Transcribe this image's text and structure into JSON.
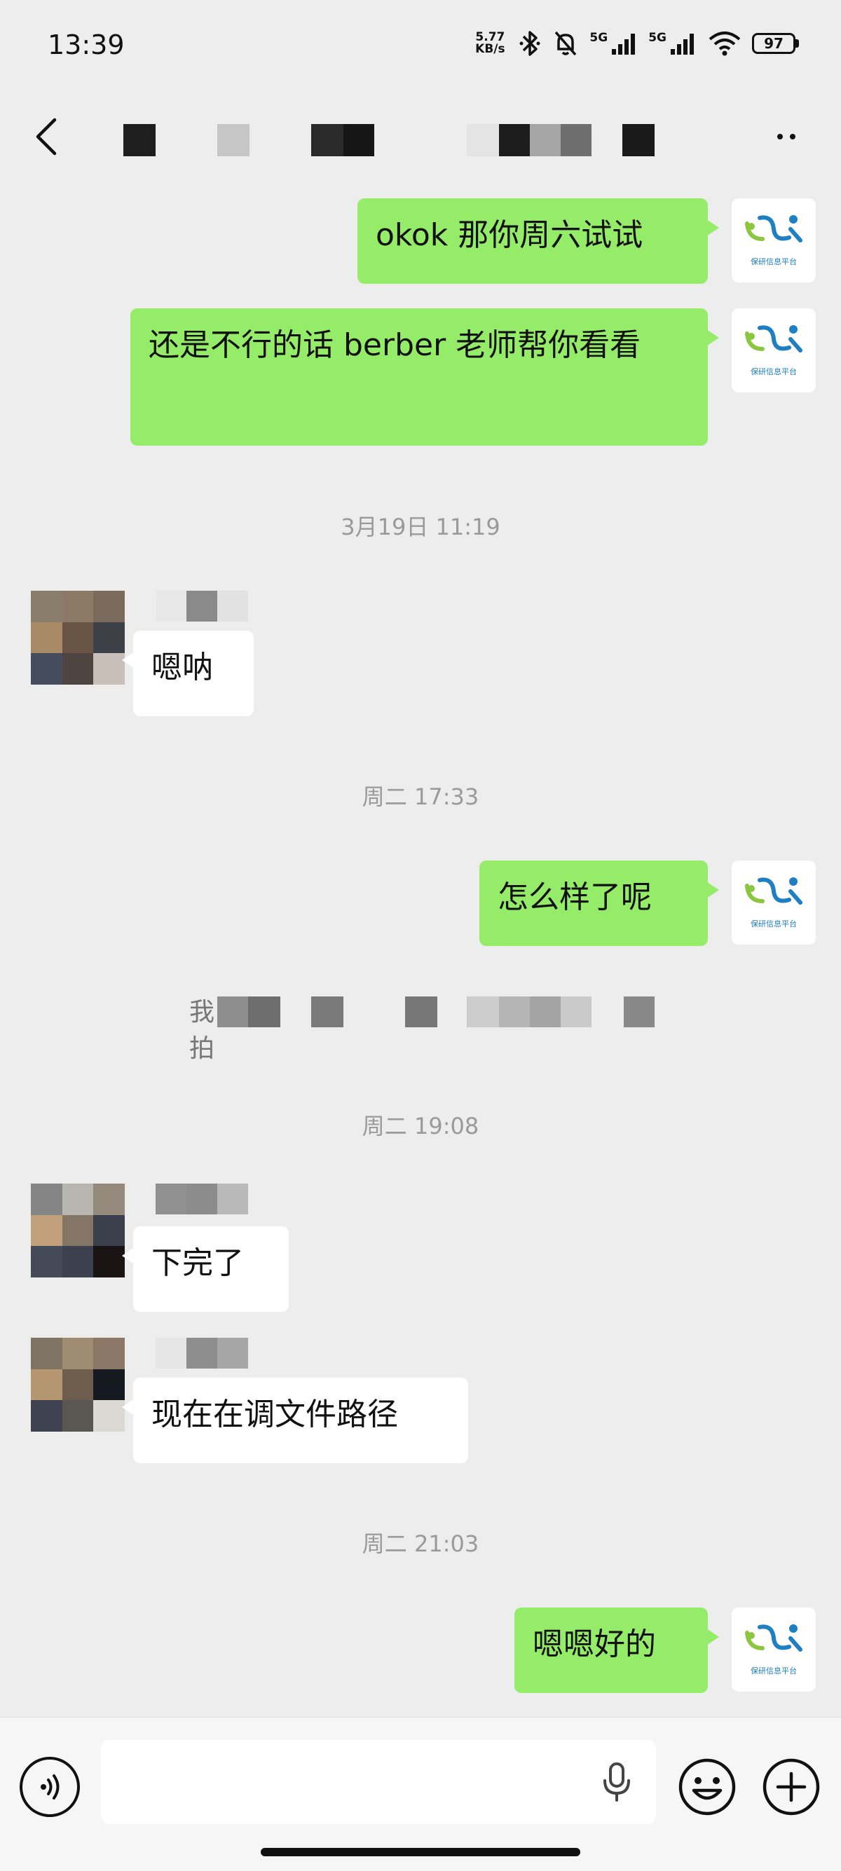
{
  "status_bar": {
    "time": "13:39",
    "net_speed_value": "5.77",
    "net_speed_unit": "KB/s",
    "signal_1_label": "5G",
    "signal_2_label": "5G",
    "battery": "97"
  },
  "messages": [
    {
      "direction": "out",
      "text": "okok 那你周六试试"
    },
    {
      "direction": "out",
      "text": "还是不行的话 berber 老师帮你看看"
    },
    {
      "direction": "in",
      "text": "嗯呐"
    },
    {
      "direction": "out",
      "text": "怎么样了呢"
    },
    {
      "direction": "in",
      "text": "下完了"
    },
    {
      "direction": "in",
      "text": "现在在调文件路径"
    },
    {
      "direction": "out",
      "text": "嗯嗯好的"
    }
  ],
  "timestamps": [
    "3月19日 11:19",
    "周二 17:33",
    "周二 19:08",
    "周二 21:03"
  ],
  "system_note_visible_fragment": "我拍",
  "self_avatar_caption": "保研信息平台",
  "colors": {
    "background": "#ededed",
    "outgoing_bubble": "#95ec69",
    "incoming_bubble": "#ffffff",
    "timestamp_text": "#9a9a9a"
  },
  "icons": {
    "back": "chevron-left-icon",
    "more": "more-dots-icon",
    "voice": "voice-mode-icon",
    "mic": "microphone-icon",
    "emoji": "emoji-icon",
    "plus": "plus-icon"
  }
}
